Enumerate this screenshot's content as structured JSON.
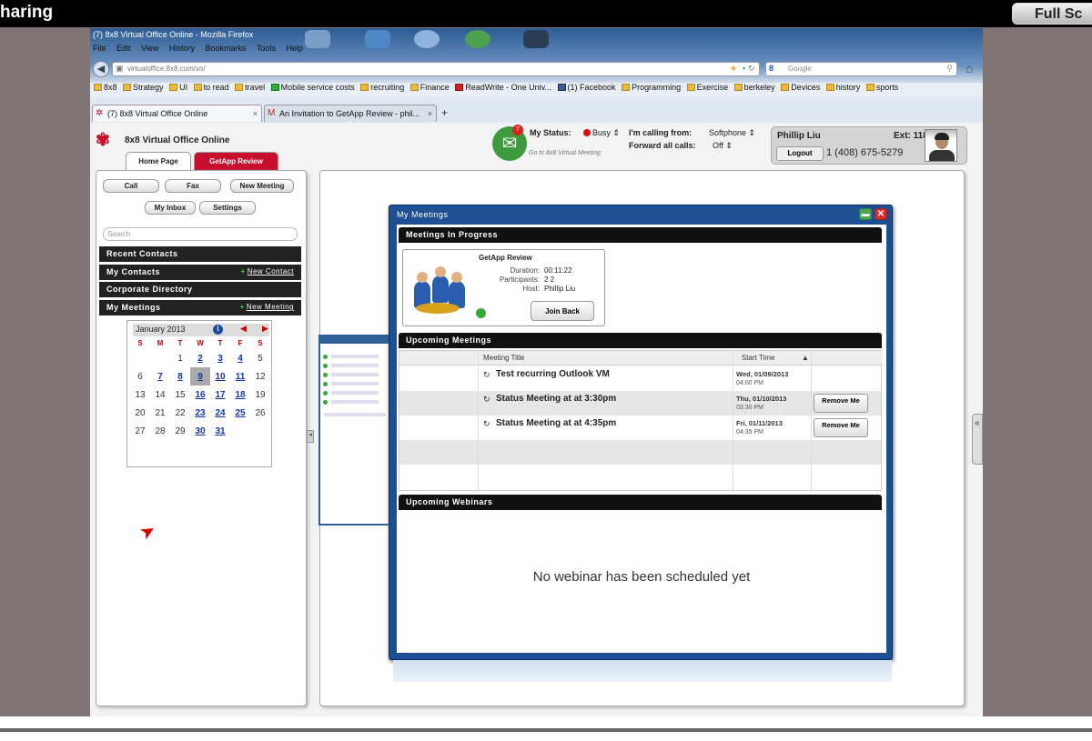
{
  "share": {
    "title": "haring",
    "fullscreen_label": "Full Sc"
  },
  "browser": {
    "window_title": "(7) 8x8 Virtual Office Online - Mozilla Firefox",
    "menu": [
      "File",
      "Edit",
      "View",
      "History",
      "Bookmarks",
      "Tools",
      "Help"
    ],
    "url": "virtualoffice.8x8.com/vo/",
    "search_placeholder": "Google",
    "bookmarks": [
      "8x8",
      "Strategy",
      "UI",
      "to read",
      "travel",
      "Mobile service costs",
      "recruiting",
      "Finance",
      "ReadWrite - One Univ...",
      "(1) Facebook",
      "Programming",
      "Exercise",
      "berkeley",
      "Devices",
      "history",
      "sports"
    ],
    "tabs": [
      {
        "label": "(7) 8x8 Virtual Office Online"
      },
      {
        "label": "An Invitation to GetApp Review - phil..."
      }
    ]
  },
  "app": {
    "logo_text": "8x8 Virtual Office Online",
    "tabs": [
      "Home Page",
      "GetApp Review"
    ],
    "status_badge": "7",
    "status_caption": "Go to 8x8 Virtual Meeting",
    "my_status_label": "My Status:",
    "my_status_value": "Busy",
    "calling_from_label": "I'm calling from:",
    "calling_from_value": "Softphone",
    "forward_label": "Forward all calls:",
    "forward_value": "Off",
    "user": {
      "name": "Phillip Liu",
      "ext": "Ext: 1183",
      "logout": "Logout",
      "phone": "1 (408) 675-5279"
    }
  },
  "sidebar": {
    "buttons": {
      "call": "Call",
      "fax": "Fax",
      "new_meeting": "New Meeting",
      "my_inbox": "My Inbox",
      "settings": "Settings"
    },
    "search_placeholder": "Search",
    "sections": {
      "recent_contacts": "Recent Contacts",
      "my_contacts": "My Contacts",
      "new_contact": "New Contact",
      "corporate_directory": "Corporate Directory",
      "my_meetings": "My Meetings",
      "new_meeting_link": "New Meeting"
    },
    "calendar": {
      "month": "January 2013",
      "days": [
        "S",
        "M",
        "T",
        "W",
        "T",
        "F",
        "S"
      ],
      "weeks": [
        [
          "",
          "",
          "1",
          "2",
          "3",
          "4",
          "5"
        ],
        [
          "6",
          "7",
          "8",
          "9",
          "10",
          "11",
          "12"
        ],
        [
          "13",
          "14",
          "15",
          "16",
          "17",
          "18",
          "19"
        ],
        [
          "20",
          "21",
          "22",
          "23",
          "24",
          "25",
          "26"
        ],
        [
          "27",
          "28",
          "29",
          "30",
          "31",
          "",
          ""
        ]
      ],
      "event_days": [
        "2",
        "3",
        "4",
        "7",
        "8",
        "9",
        "10",
        "11",
        "16",
        "17",
        "18",
        "23",
        "24",
        "25",
        "30",
        "31"
      ],
      "today": "9"
    }
  },
  "dialog": {
    "title": "My Meetings",
    "in_progress_header": "Meetings In Progress",
    "in_progress": {
      "title": "GetApp Review",
      "duration_label": "Duration:",
      "duration": "00:11:22",
      "participants_label": "Participants:",
      "participants": "2 2",
      "host_label": "Host:",
      "host": "Phillip Liu",
      "join_back": "Join Back"
    },
    "upcoming_header": "Upcoming Meetings",
    "columns": {
      "title": "Meeting Title",
      "start": "Start Time"
    },
    "meetings": [
      {
        "title": "Test recurring Outlook VM",
        "date": "Wed, 01/09/2013",
        "time": "04:00 PM",
        "action": ""
      },
      {
        "title": "Status Meeting at at 3:30pm",
        "date": "Thu, 01/10/2013",
        "time": "03:30 PM",
        "action": "Remove Me"
      },
      {
        "title": "Status Meeting at at 4:35pm",
        "date": "Fri, 01/11/2013",
        "time": "04:35 PM",
        "action": "Remove Me"
      }
    ],
    "webinars_header": "Upcoming Webinars",
    "no_webinar": "No webinar has been scheduled yet"
  },
  "bottom_icons": {
    "calendar_day": "9"
  }
}
